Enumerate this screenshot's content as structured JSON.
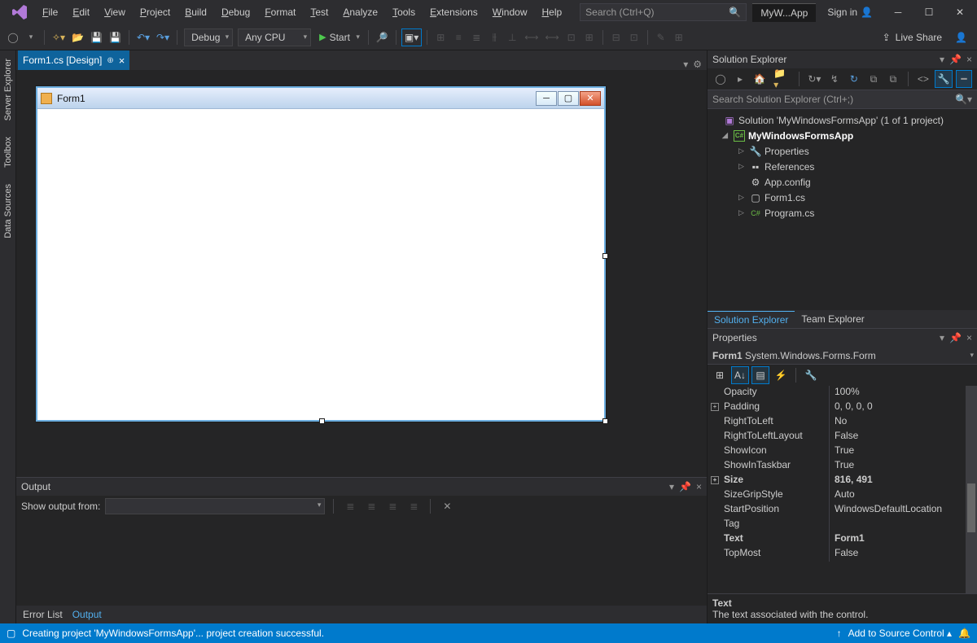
{
  "title": {
    "app_name": "MyW...App",
    "sign_in": "Sign in",
    "search_placeholder": "Search (Ctrl+Q)"
  },
  "menu": [
    "File",
    "Edit",
    "View",
    "Project",
    "Build",
    "Debug",
    "Format",
    "Test",
    "Analyze",
    "Tools",
    "Extensions",
    "Window",
    "Help"
  ],
  "toolbar": {
    "config": "Debug",
    "platform": "Any CPU",
    "start": "Start",
    "live_share": "Live Share"
  },
  "side_tabs": [
    "Server Explorer",
    "Toolbox",
    "Data Sources"
  ],
  "doc_tab": "Form1.cs [Design]",
  "form_title": "Form1",
  "output": {
    "panel_title": "Output",
    "show_from": "Show output from:",
    "tabs": [
      "Error List",
      "Output"
    ]
  },
  "solution": {
    "panel_title": "Solution Explorer",
    "search_placeholder": "Search Solution Explorer (Ctrl+;)",
    "root": "Solution 'MyWindowsFormsApp' (1 of 1 project)",
    "project": "MyWindowsFormsApp",
    "nodes": {
      "properties": "Properties",
      "references": "References",
      "appconfig": "App.config",
      "form1": "Form1.cs",
      "program": "Program.cs"
    },
    "tabs": [
      "Solution Explorer",
      "Team Explorer"
    ]
  },
  "properties": {
    "panel_title": "Properties",
    "object_name": "Form1",
    "object_type": "System.Windows.Forms.Form",
    "rows": [
      {
        "k": "Opacity",
        "v": "100%"
      },
      {
        "k": "Padding",
        "v": "0, 0, 0, 0",
        "exp": "+"
      },
      {
        "k": "RightToLeft",
        "v": "No"
      },
      {
        "k": "RightToLeftLayout",
        "v": "False"
      },
      {
        "k": "ShowIcon",
        "v": "True"
      },
      {
        "k": "ShowInTaskbar",
        "v": "True"
      },
      {
        "k": "Size",
        "v": "816, 491",
        "exp": "+",
        "bold": true
      },
      {
        "k": "SizeGripStyle",
        "v": "Auto"
      },
      {
        "k": "StartPosition",
        "v": "WindowsDefaultLocation"
      },
      {
        "k": "Tag",
        "v": ""
      },
      {
        "k": "Text",
        "v": "Form1",
        "bold": true
      },
      {
        "k": "TopMost",
        "v": "False"
      }
    ],
    "desc_title": "Text",
    "desc_body": "The text associated with the control."
  },
  "status": {
    "msg": "Creating project 'MyWindowsFormsApp'... project creation successful.",
    "source_control": "Add to Source Control"
  }
}
